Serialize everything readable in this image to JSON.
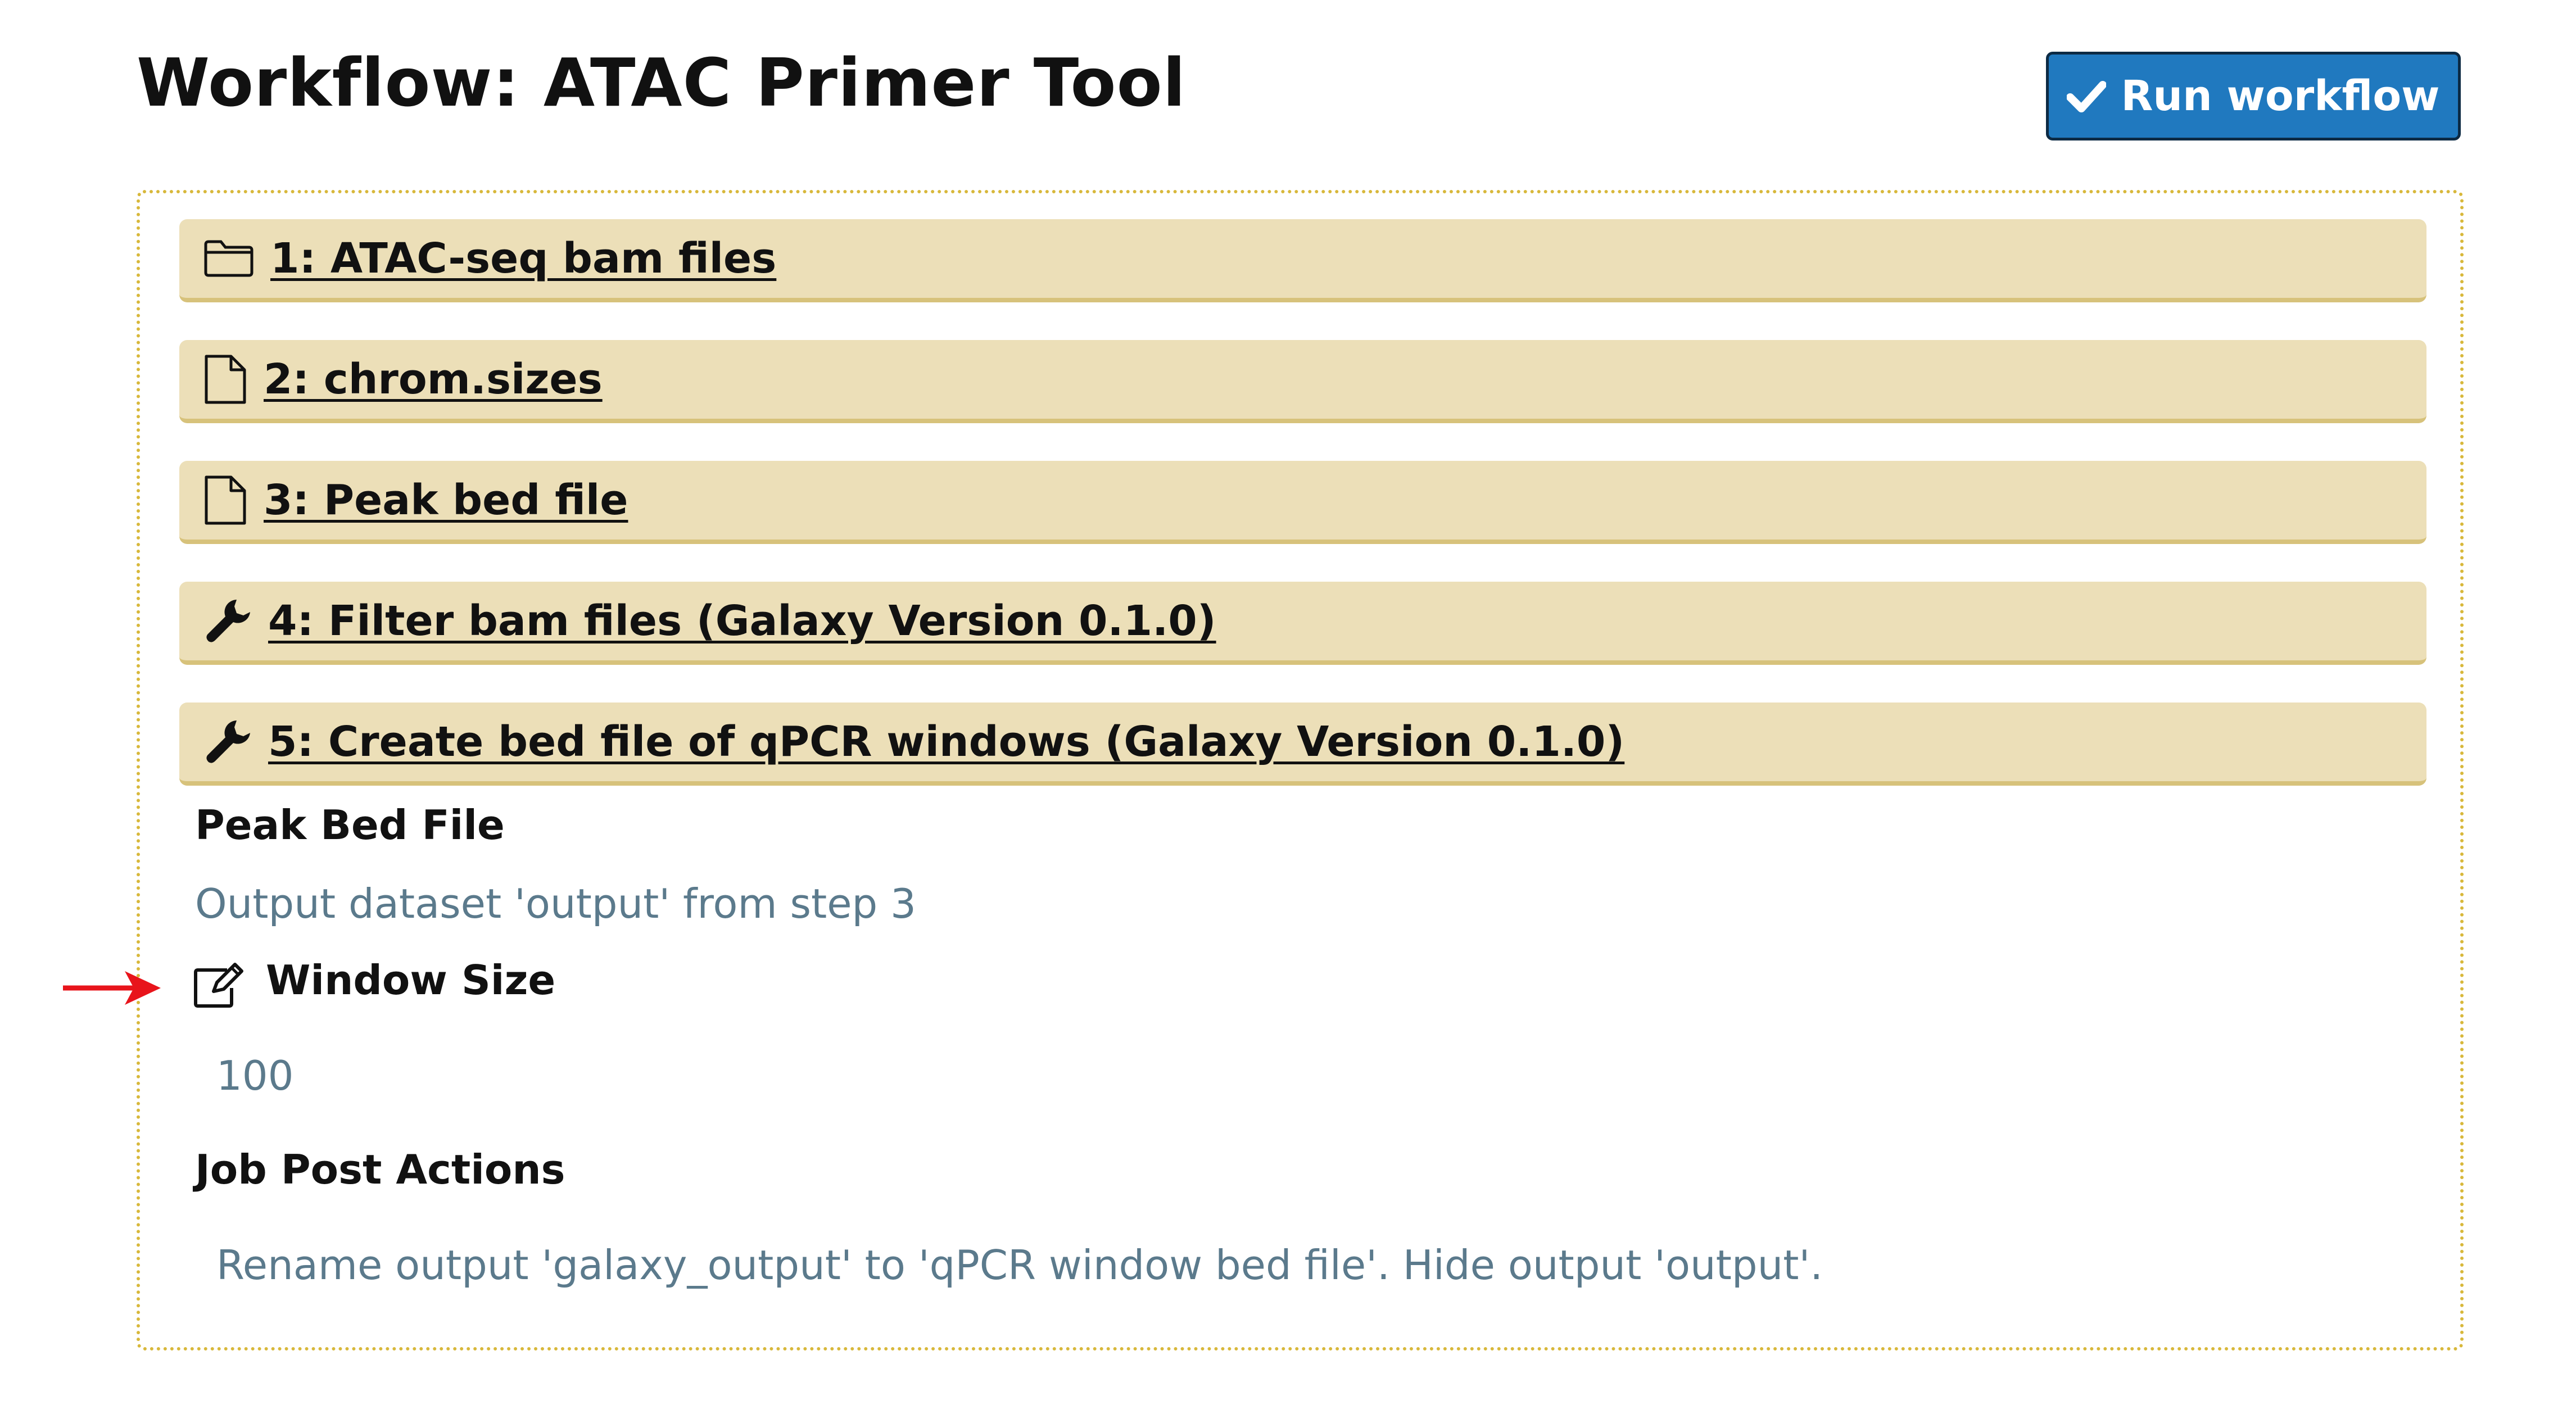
{
  "header": {
    "title": "Workflow: ATAC Primer Tool",
    "run_button_label": "Run workflow"
  },
  "steps": [
    {
      "label": "1: ATAC-seq bam files",
      "icon": "folder-icon"
    },
    {
      "label": "2: chrom.sizes",
      "icon": "file-icon"
    },
    {
      "label": "3: Peak bed file",
      "icon": "file-icon"
    },
    {
      "label": "4: Filter bam files (Galaxy Version 0.1.0)",
      "icon": "wrench-icon"
    },
    {
      "label": "5: Create bed file of qPCR windows (Galaxy Version 0.1.0)",
      "icon": "wrench-icon"
    }
  ],
  "step5_details": {
    "peak_bed_file_label": "Peak Bed File",
    "peak_bed_file_value": "Output dataset 'output' from step 3",
    "window_size_label": "Window Size",
    "window_size_value": "100",
    "job_post_actions_label": "Job Post Actions",
    "job_post_actions_value": "Rename output 'galaxy_output' to 'qPCR window bed file'. Hide output 'output'."
  },
  "colors": {
    "accent": "#2079bf",
    "step_background": "#ecdfb8",
    "border_dotted": "#d8b83b",
    "muted_text": "#5b7a8c",
    "annotation_arrow": "#e8141b"
  }
}
